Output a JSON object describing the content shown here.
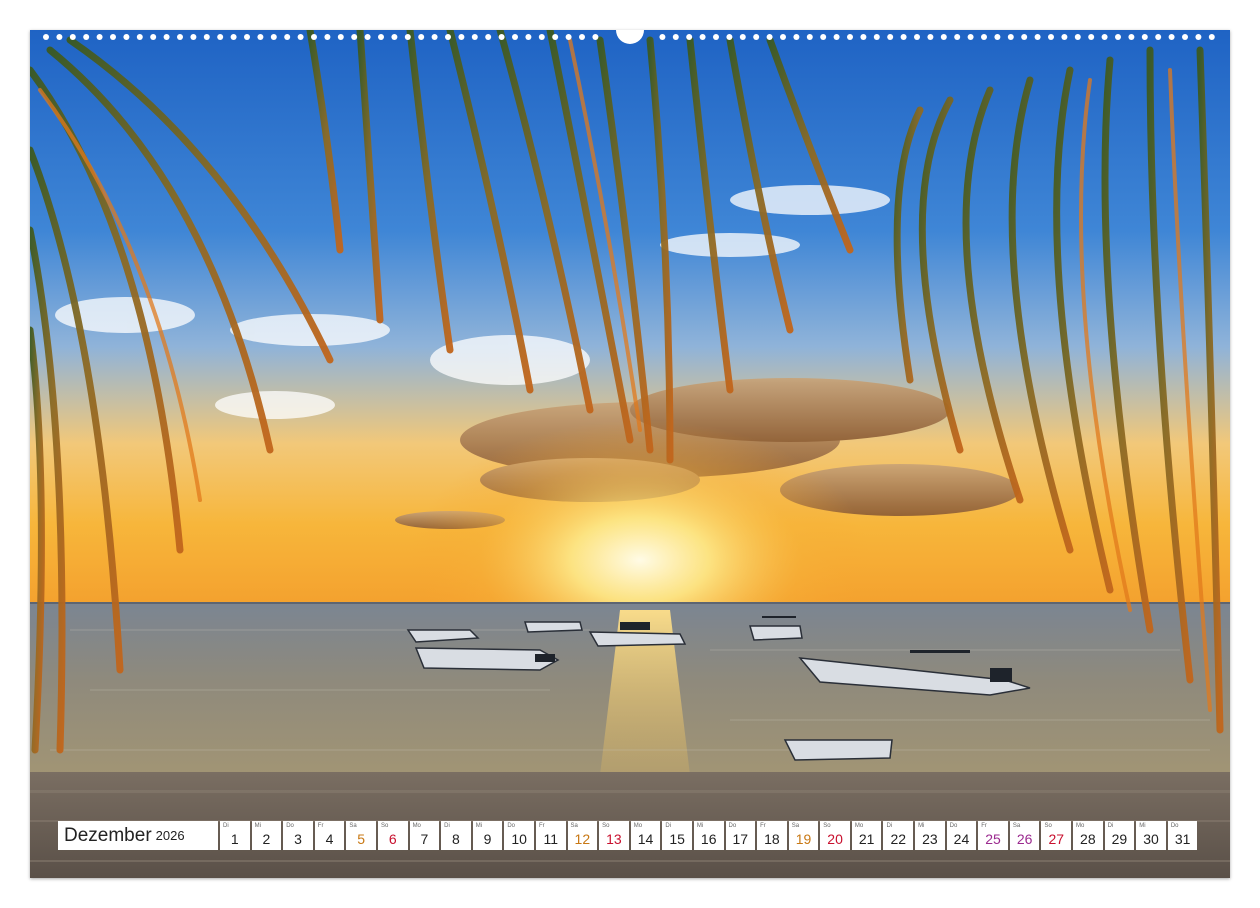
{
  "calendar": {
    "month": "Dezember",
    "year": "2026",
    "days": [
      {
        "num": "1",
        "abbr": "Di",
        "type": "weekday"
      },
      {
        "num": "2",
        "abbr": "Mi",
        "type": "weekday"
      },
      {
        "num": "3",
        "abbr": "Do",
        "type": "weekday"
      },
      {
        "num": "4",
        "abbr": "Fr",
        "type": "weekday"
      },
      {
        "num": "5",
        "abbr": "Sa",
        "type": "sat"
      },
      {
        "num": "6",
        "abbr": "So",
        "type": "sun"
      },
      {
        "num": "7",
        "abbr": "Mo",
        "type": "weekday"
      },
      {
        "num": "8",
        "abbr": "Di",
        "type": "weekday"
      },
      {
        "num": "9",
        "abbr": "Mi",
        "type": "weekday"
      },
      {
        "num": "10",
        "abbr": "Do",
        "type": "weekday"
      },
      {
        "num": "11",
        "abbr": "Fr",
        "type": "weekday"
      },
      {
        "num": "12",
        "abbr": "Sa",
        "type": "sat"
      },
      {
        "num": "13",
        "abbr": "So",
        "type": "sun"
      },
      {
        "num": "14",
        "abbr": "Mo",
        "type": "weekday"
      },
      {
        "num": "15",
        "abbr": "Di",
        "type": "weekday"
      },
      {
        "num": "16",
        "abbr": "Mi",
        "type": "weekday"
      },
      {
        "num": "17",
        "abbr": "Do",
        "type": "weekday"
      },
      {
        "num": "18",
        "abbr": "Fr",
        "type": "weekday"
      },
      {
        "num": "19",
        "abbr": "Sa",
        "type": "sat"
      },
      {
        "num": "20",
        "abbr": "So",
        "type": "sun"
      },
      {
        "num": "21",
        "abbr": "Mo",
        "type": "weekday"
      },
      {
        "num": "22",
        "abbr": "Di",
        "type": "weekday"
      },
      {
        "num": "23",
        "abbr": "Mi",
        "type": "weekday"
      },
      {
        "num": "24",
        "abbr": "Do",
        "type": "weekday"
      },
      {
        "num": "25",
        "abbr": "Fr",
        "type": "holiday"
      },
      {
        "num": "26",
        "abbr": "Sa",
        "type": "holiday"
      },
      {
        "num": "27",
        "abbr": "So",
        "type": "sun"
      },
      {
        "num": "28",
        "abbr": "Mo",
        "type": "weekday"
      },
      {
        "num": "29",
        "abbr": "Di",
        "type": "weekday"
      },
      {
        "num": "30",
        "abbr": "Mi",
        "type": "weekday"
      },
      {
        "num": "31",
        "abbr": "Do",
        "type": "weekday"
      }
    ]
  },
  "colors": {
    "saturday": "#c87814",
    "sunday": "#c8102e",
    "holiday": "#9b2a8f"
  },
  "photo_subject": "palm-fronds-sunset-beach-boats"
}
